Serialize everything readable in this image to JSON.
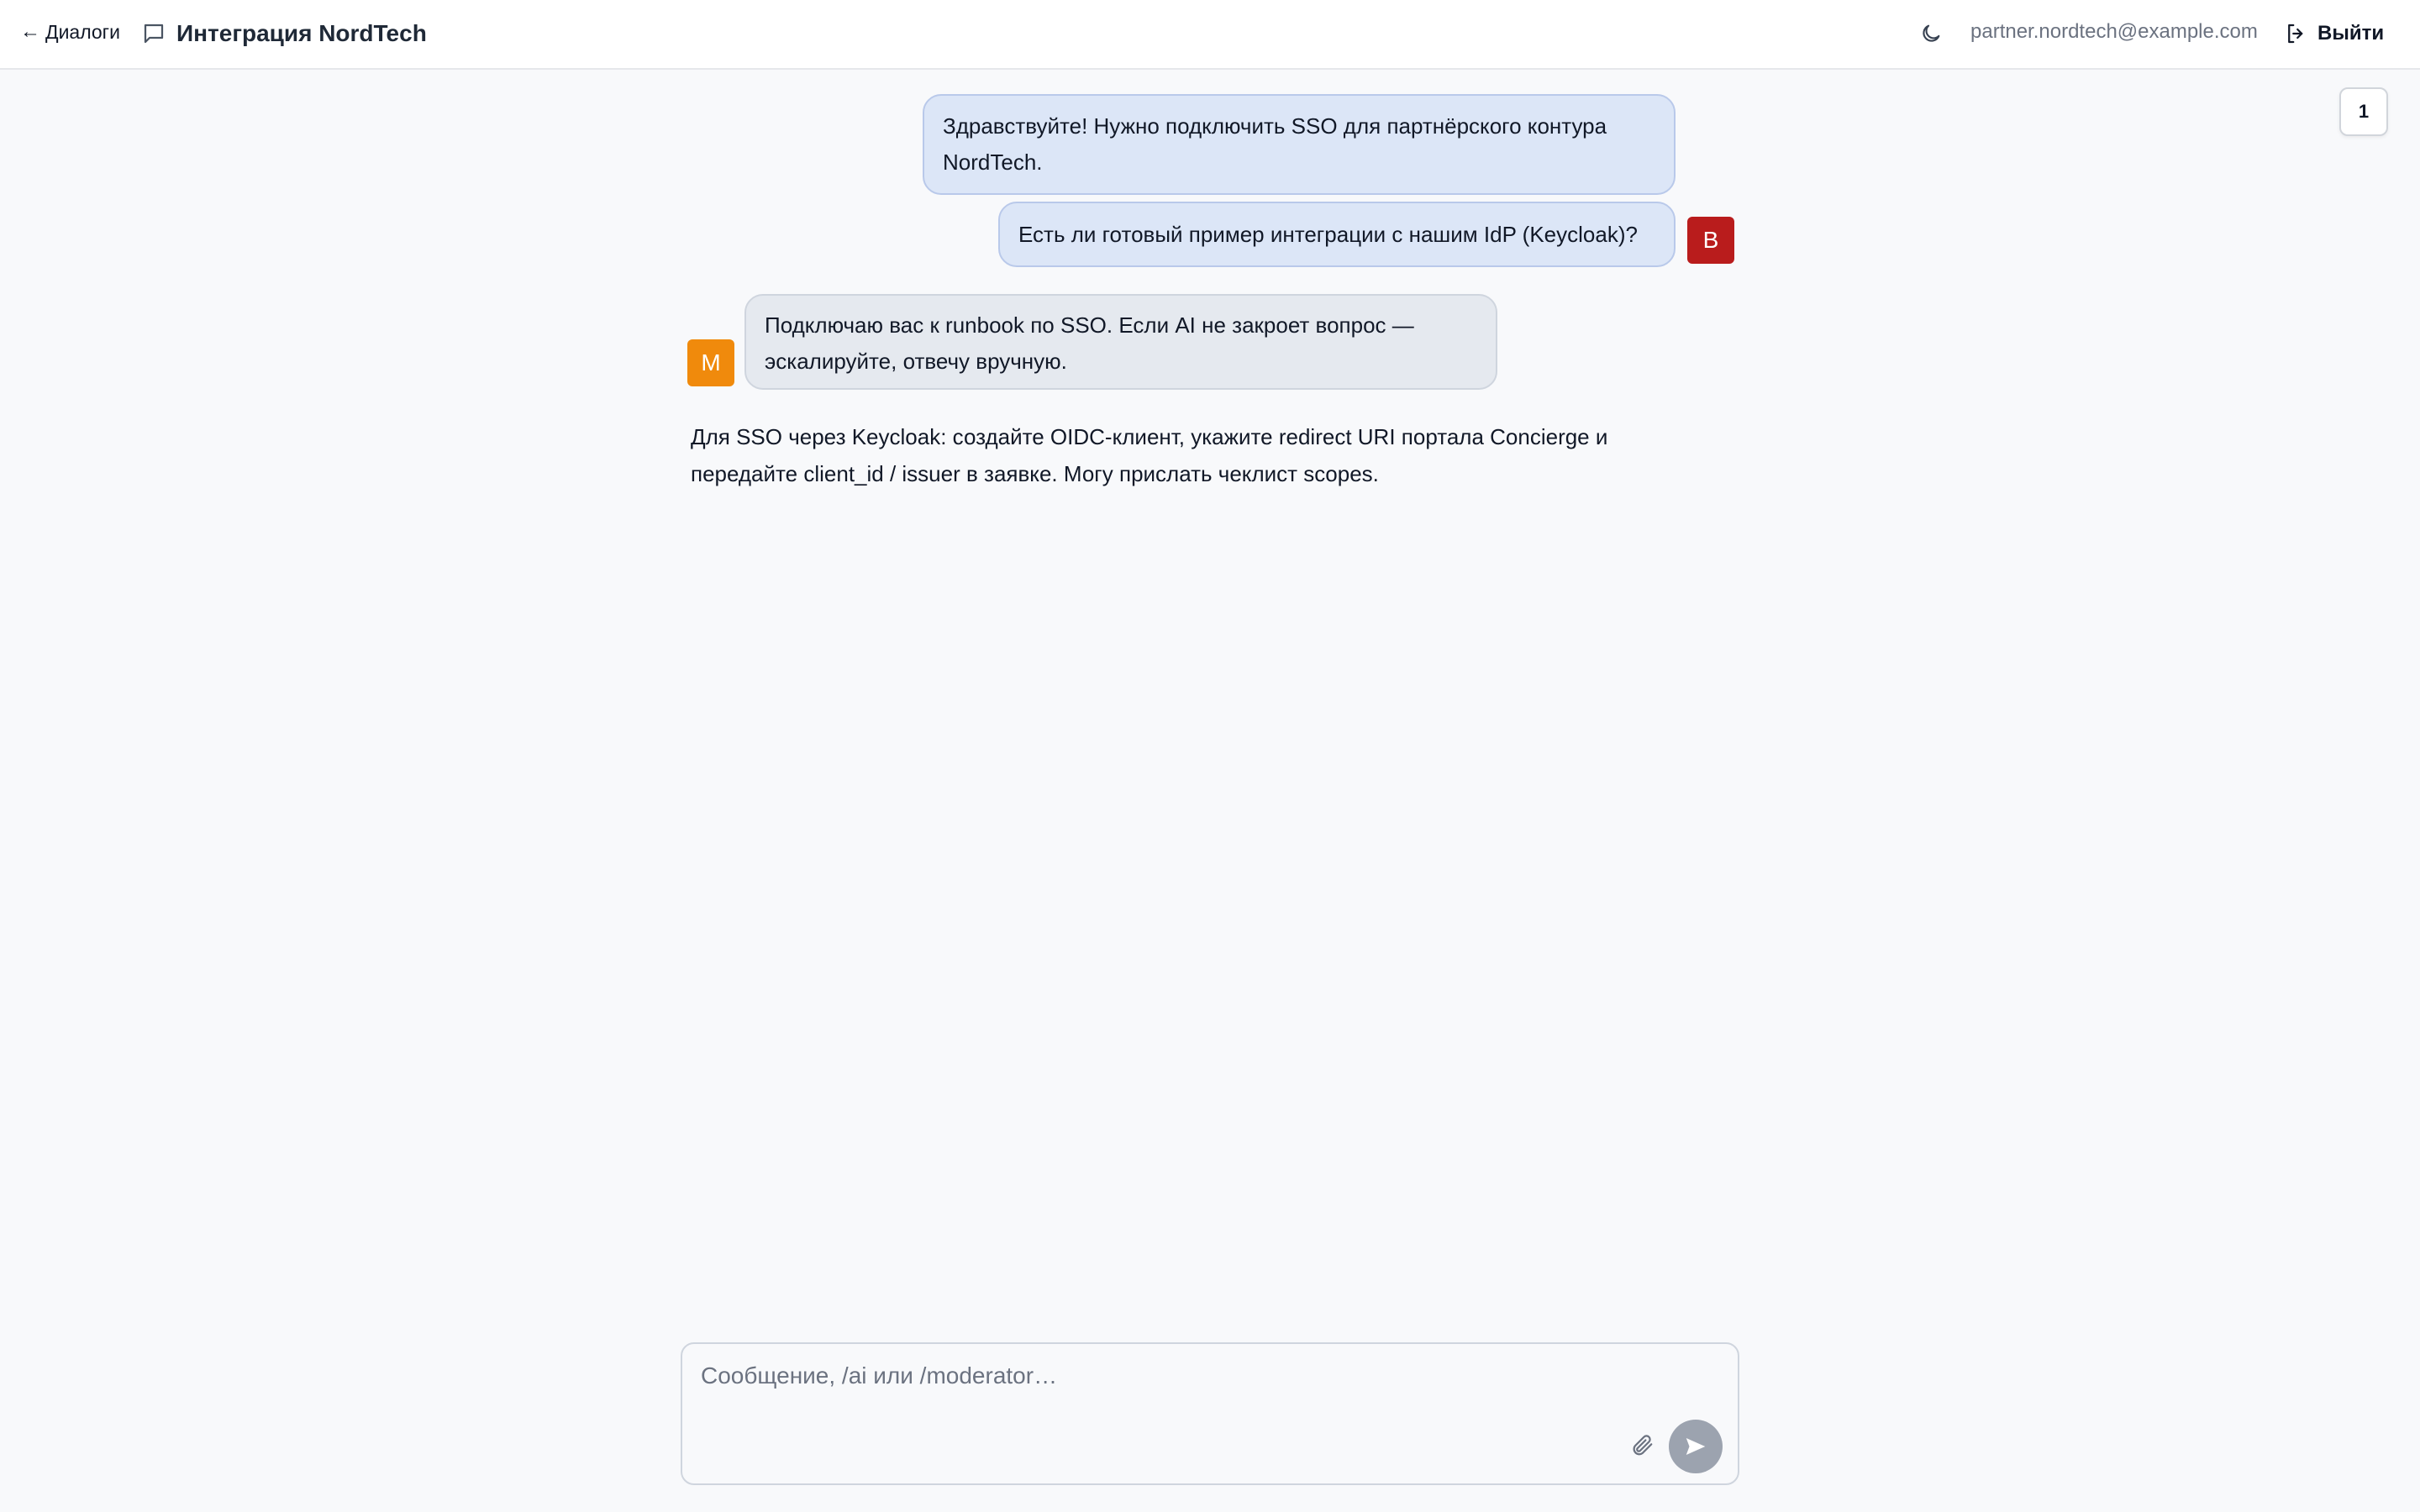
{
  "header": {
    "back_label": "Диалоги",
    "chat_title": "Интеграция NordTech",
    "user_email": "partner.nordtech@example.com",
    "logout_label": "Выйти"
  },
  "counter": {
    "value": "1"
  },
  "messages": [
    {
      "direction": "outgoing",
      "text": "Здравствуйте! Нужно подключить SSO для партнёрского контура NordTech."
    },
    {
      "direction": "outgoing",
      "text": "Есть ли готовый пример интеграции с нашим IdP (Keycloak)?",
      "avatar_letter": "B"
    },
    {
      "direction": "incoming",
      "text": "Подключаю вас к runbook по SSO. Если AI не закроет вопрос — эскалируйте, отвечу вручную.",
      "avatar_letter": "M"
    },
    {
      "direction": "incoming-plain",
      "text": "Для SSO через Keycloak: создайте OIDC-клиент, укажите redirect URI портала Concierge и передайте client_id / issuer в заявке. Могу прислать чеклист scopes."
    }
  ],
  "composer": {
    "placeholder": "Сообщение, /ai или /moderator…",
    "value": ""
  },
  "colors": {
    "outgoing_bubble": "#dce6f7",
    "incoming_bubble": "#e5e9ef",
    "avatar_b": "#b91c1c",
    "avatar_m": "#f08a0c",
    "send_button": "#9ca3af"
  },
  "icons": {
    "back": "arrow-left-icon",
    "chat": "chat-bubble-icon",
    "theme": "moon-icon",
    "logout": "logout-icon",
    "attach": "paperclip-icon",
    "send": "send-icon"
  }
}
